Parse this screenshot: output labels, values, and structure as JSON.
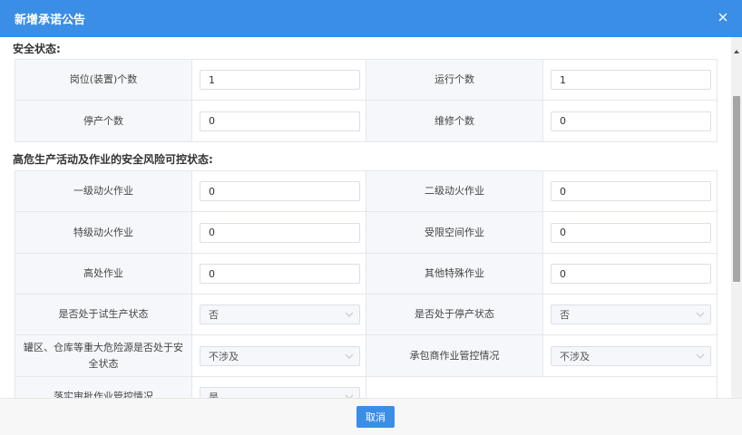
{
  "dialog": {
    "title": "新增承诺公告"
  },
  "safety_status": {
    "heading": "安全状态:",
    "rows": [
      {
        "label_left": "岗位(装置)个数",
        "value_left": "1",
        "label_right": "运行个数",
        "value_right": "1"
      },
      {
        "label_left": "停产个数",
        "value_left": "0",
        "label_right": "维修个数",
        "value_right": "0"
      }
    ]
  },
  "risk_status": {
    "heading": "高危生产活动及作业的安全风险可控状态:",
    "rows": [
      {
        "label_left": "一级动火作业",
        "value_left": "0",
        "label_right": "二级动火作业",
        "value_right": "0"
      },
      {
        "label_left": "特级动火作业",
        "value_left": "0",
        "label_right": "受限空间作业",
        "value_right": "0"
      },
      {
        "label_left": "高处作业",
        "value_left": "0",
        "label_right": "其他特殊作业",
        "value_right": "0"
      },
      {
        "label_left": "是否处于试生产状态",
        "value_left": "否",
        "label_right": "是否处于停产状态",
        "value_right": "否"
      },
      {
        "label_left": "罐区、仓库等重大危险源是否处于安全状态",
        "value_left": "不涉及",
        "label_right": "承包商作业管控情况",
        "value_right": "不涉及"
      },
      {
        "label_left": "落实审批作业管控情况",
        "value_left": "是"
      }
    ]
  },
  "footer": {
    "cancel_label": "取消"
  },
  "icons": {
    "close": "close-icon",
    "dropdown": "chevron-down-icon"
  },
  "colors": {
    "primary": "#3a8ee6",
    "label_bg": "#f5f7fa",
    "border": "#e4e7ed"
  }
}
